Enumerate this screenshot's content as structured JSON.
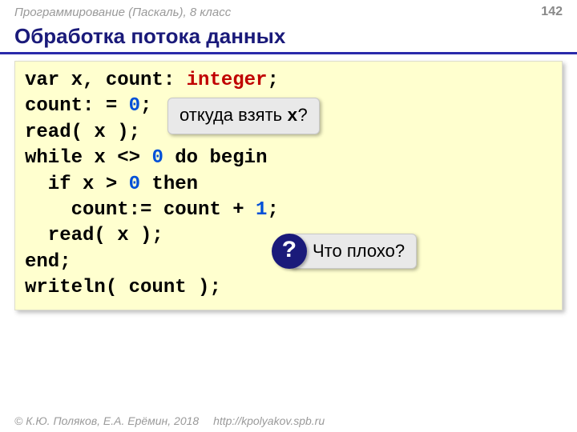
{
  "header": {
    "course": "Программирование (Паскаль), 8 класс",
    "page": "142"
  },
  "title": "Обработка потока данных",
  "code": {
    "l1a": "var x, count: ",
    "l1b": "integer",
    "l1c": ";",
    "l2a": "count:",
    "l2b": "=",
    "l2c": "0",
    "l2d": ";",
    "l3": "read( x );",
    "l4a": "while x <> ",
    "l4b": "0",
    "l4c": " do begin",
    "l5a": "  if x > ",
    "l5b": "0",
    "l5c": " then",
    "l6a": "    count:= count + ",
    "l6b": "1",
    "l6c": ";",
    "l7": "  read( x );",
    "l8": "end;",
    "l9": "writeln( count );"
  },
  "callouts": {
    "where_x_pre": "откуда взять ",
    "where_x_var": "x",
    "where_x_post": "?",
    "qmark": "?",
    "whats_bad": "Что плохо?"
  },
  "footer": {
    "copyright": "© К.Ю. Поляков, Е.А. Ерёмин, 2018",
    "url": "http://kpolyakov.spb.ru"
  }
}
